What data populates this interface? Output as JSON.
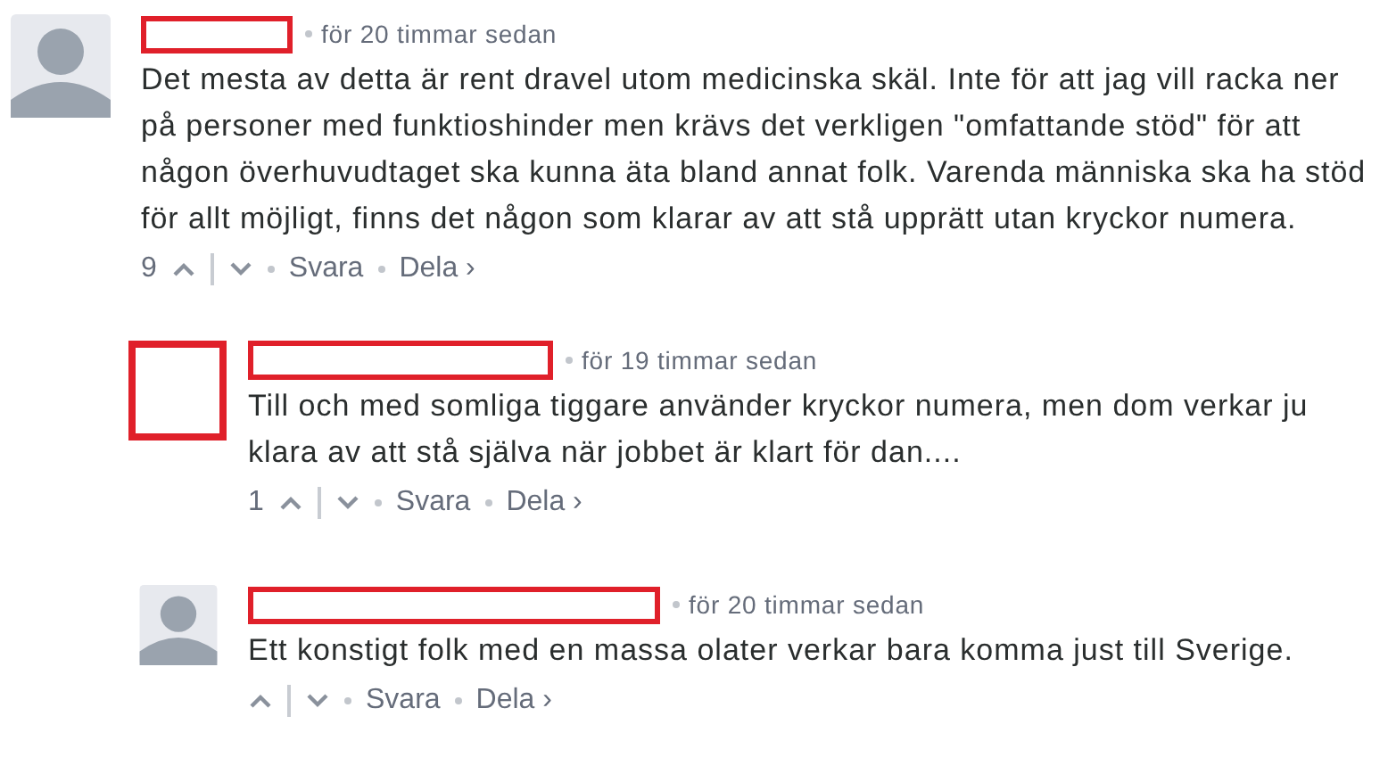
{
  "comments": [
    {
      "kind": "placeholder",
      "time": "för 20 timmar sedan",
      "text": "Det mesta av detta är rent dravel utom medicinska skäl. Inte för att jag vill racka ner på personer med funktioshinder men krävs det verkligen \"omfattande stöd\" för att någon överhuvudtaget ska kunna äta bland annat folk. Varenda människa ska ha stöd för allt möjligt, finns det någon som klarar av att stå upprätt utan kryckor numera.",
      "votes": "9",
      "reply": "Svara",
      "share": "Dela ›",
      "children": [
        {
          "kind": "redacted",
          "time": "för 19 timmar sedan",
          "text": "Till och med somliga tiggare använder kryckor numera, men dom verkar ju klara av att stå själva när jobbet är klart för dan....",
          "votes": "1",
          "reply": "Svara",
          "share": "Dela ›"
        },
        {
          "kind": "placeholder",
          "time": "för 20 timmar sedan",
          "text": "Ett konstigt folk med en massa olater verkar bara komma just till Sverige.",
          "reply": "Svara",
          "share": "Dela ›"
        }
      ]
    }
  ]
}
